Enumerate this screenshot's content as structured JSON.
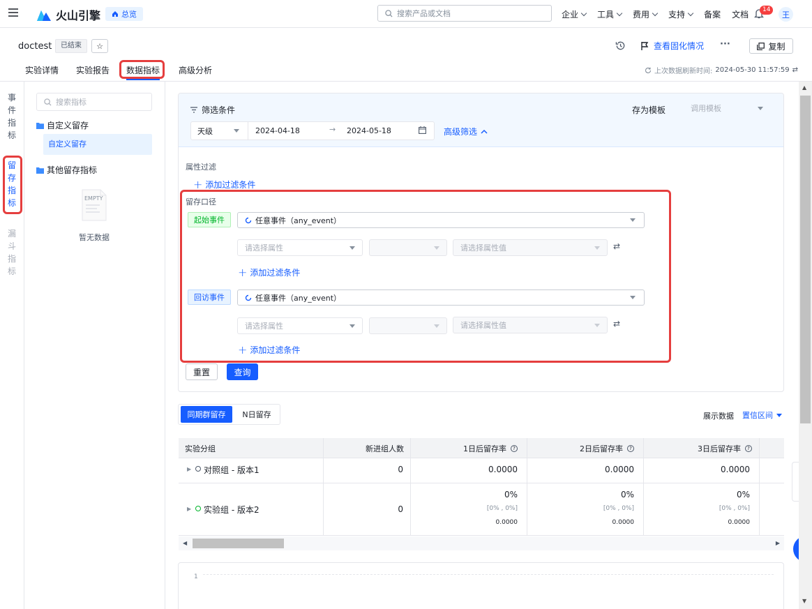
{
  "topbar": {
    "brand": "火山引擎",
    "overview_label": "总览",
    "search_placeholder": "搜索产品或文档",
    "menus": [
      "企业",
      "工具",
      "费用",
      "支持"
    ],
    "links": [
      "备案",
      "文档"
    ],
    "notification_count": "14",
    "avatar_text": "王"
  },
  "experiment": {
    "name": "doctest",
    "status": "已结束",
    "actions": {
      "view_solidify": "查看固化情况",
      "more": "···",
      "copy": "复制"
    },
    "tabs": [
      "实验详情",
      "实验报告",
      "数据指标",
      "高级分析"
    ],
    "active_tab": "数据指标",
    "refresh_label": "上次数据刷新时间:",
    "refresh_time": "2024-05-30 11:57:59"
  },
  "side_nav": {
    "items": [
      "事件指标",
      "留存指标",
      "漏斗指标"
    ],
    "active": "留存指标"
  },
  "metric_panel": {
    "search_placeholder": "搜索指标",
    "folders": [
      {
        "name": "自定义留存",
        "children": [
          "自定义留存"
        ]
      },
      {
        "name": "其他留存指标",
        "children": []
      }
    ],
    "empty_image_text": "EMPTY",
    "empty_text": "暂无数据"
  },
  "filter": {
    "title": "筛选条件",
    "save_template": "存为模板",
    "apply_template_placeholder": "调用模板",
    "granularity": "天级",
    "start_date": "2024-04-18",
    "end_date": "2024-05-18",
    "advanced_filter": "高级筛选",
    "attr_filter_label": "属性过滤",
    "add_filter_condition": "添加过滤条件",
    "retention_caliber_label": "留存口径",
    "start_event_tag": "起始事件",
    "return_event_tag": "回访事件",
    "start_event_value": "任意事件（any_event）",
    "return_event_value": "任意事件（any_event）",
    "select_attr_placeholder": "请选择属性",
    "select_attr_value_placeholder": "请选择属性值",
    "reset": "重置",
    "query": "查询"
  },
  "result": {
    "tabs": [
      "同期群留存",
      "N日留存"
    ],
    "active_tab": "同期群留存",
    "display_data_label": "展示数据",
    "display_data_value": "置信区间",
    "columns": [
      "实验分组",
      "新进组人数",
      "1日后留存率",
      "2日后留存率",
      "3日后留存率"
    ],
    "rows": [
      {
        "group": "对照组 - 版本1",
        "new_users": "0",
        "d1": "0.0000",
        "d2": "0.0000",
        "d3": "0.0000"
      },
      {
        "group": "实验组 - 版本2",
        "new_users": "0",
        "d1": "0%",
        "d1_ci": "[0% , 0%]",
        "d1_val": "0.0000",
        "d2": "0%",
        "d2_ci": "[0% , 0%]",
        "d2_val": "0.0000",
        "d3": "0%",
        "d3_ci": "[0% , 0%]",
        "d3_val": "0.0000"
      }
    ],
    "chart_y_tick": "1"
  },
  "colors": {
    "primary": "#165dff",
    "highlight_red": "#e53e3e",
    "green_tag": "#00b42a",
    "filter_bg": "#f2f8ff"
  }
}
